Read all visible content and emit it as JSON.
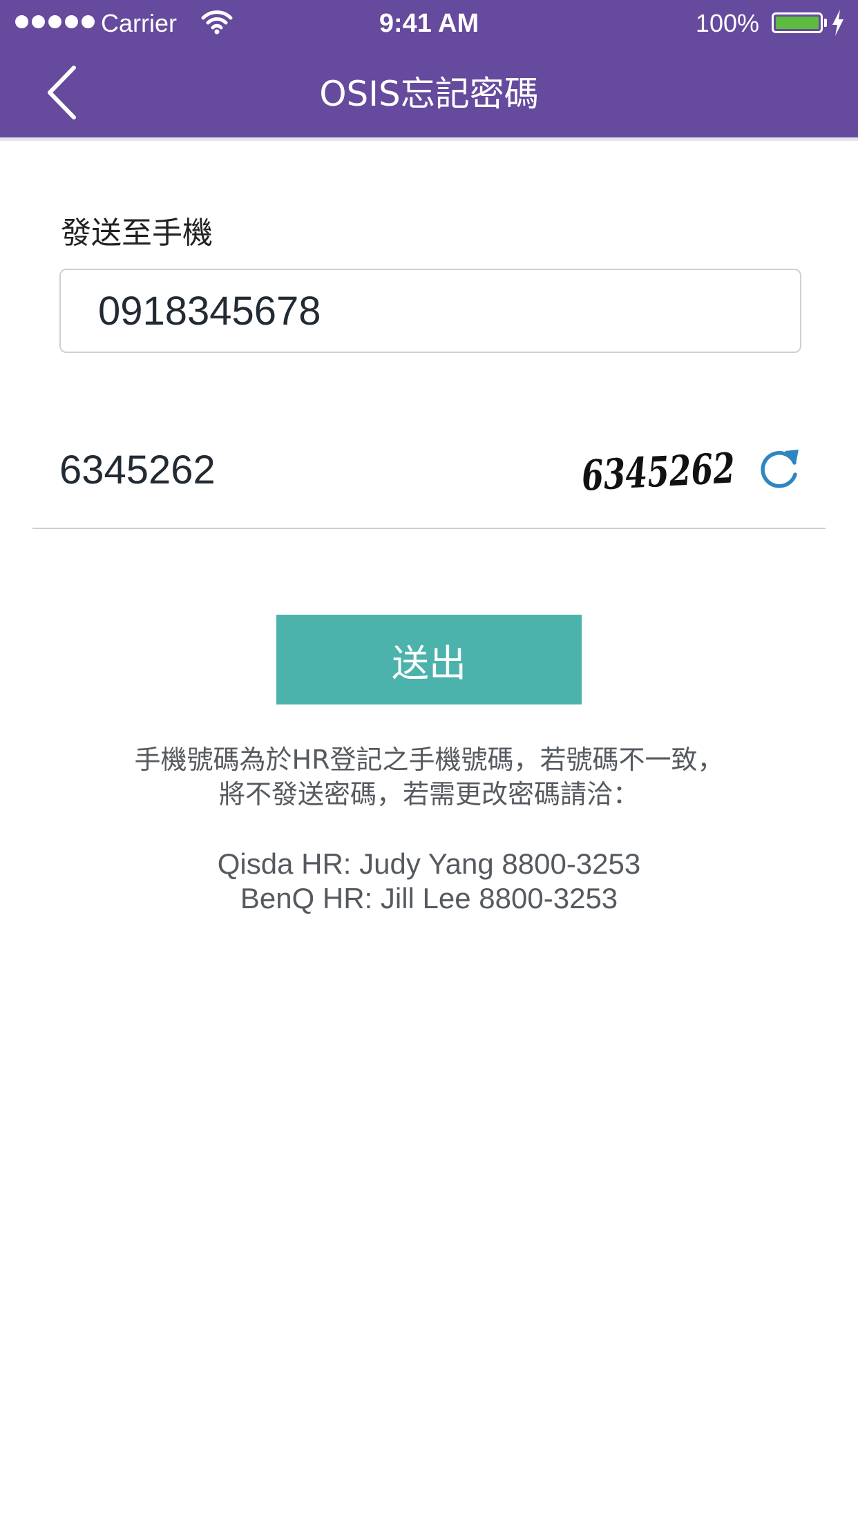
{
  "status_bar": {
    "carrier": "Carrier",
    "time": "9:41 AM",
    "battery_percent": "100%",
    "battery_level": 1.0,
    "signal_bars": 5,
    "icons": [
      "signal-dots-icon",
      "wifi-icon",
      "battery-icon",
      "charging-bolt-icon"
    ]
  },
  "nav": {
    "title": "OSIS忘記密碼",
    "back_icon": "chevron-left-icon",
    "background_color": "#654a9d"
  },
  "form": {
    "phone_label": "發送至手機",
    "phone_value": "0918345678",
    "captcha_value": "6345262",
    "captcha_image_text": "6345262",
    "refresh_icon": "refresh-icon",
    "refresh_color": "#2e86c1"
  },
  "submit": {
    "label": "送出",
    "color": "#4bb3ab"
  },
  "notice": {
    "line1": "手機號碼為於HR登記之手機號碼，若號碼不一致，",
    "line2": "將不發送密碼，若需更改密碼請洽："
  },
  "contacts": {
    "qisda": "Qisda HR: Judy Yang 8800-3253",
    "benq": "BenQ HR: Jill Lee 8800-3253"
  }
}
